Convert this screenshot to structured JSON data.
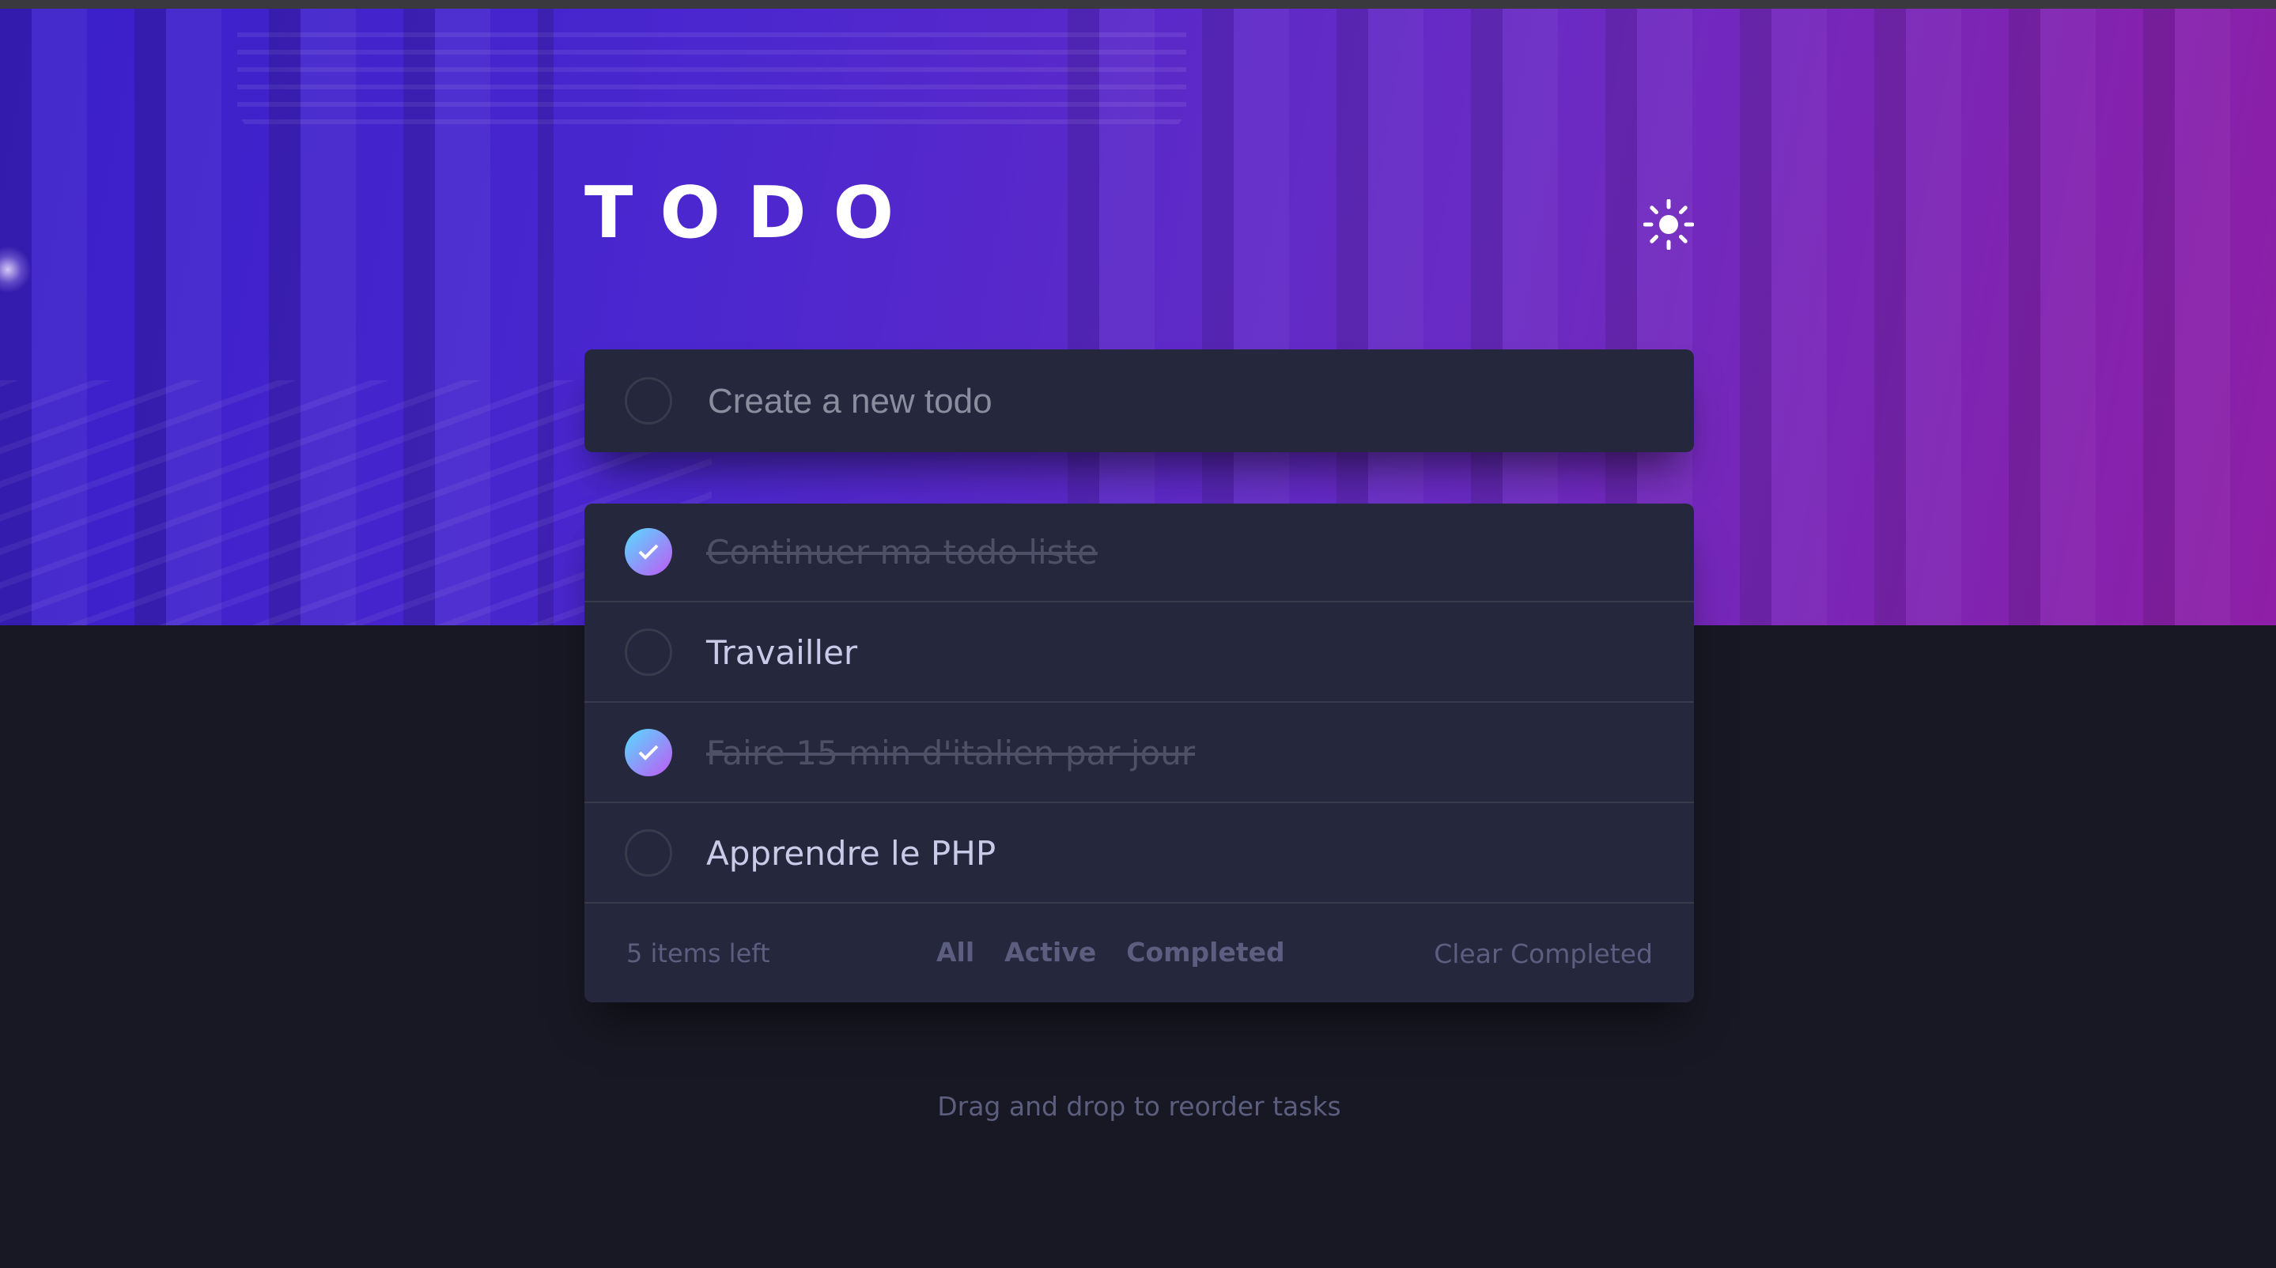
{
  "app": {
    "title": "TODO",
    "theme_icon": "sun-icon",
    "accent_gradient": [
      "#55ddff",
      "#c058f3"
    ]
  },
  "new_todo": {
    "placeholder": "Create a new todo",
    "value": ""
  },
  "todos": [
    {
      "text": "Continuer ma todo liste",
      "completed": true
    },
    {
      "text": "Travailler",
      "completed": false
    },
    {
      "text": "Faire 15 min d'italien par jour",
      "completed": true
    },
    {
      "text": "Apprendre le PHP",
      "completed": false
    }
  ],
  "footer": {
    "items_left": "5 items left",
    "filters": [
      "All",
      "Active",
      "Completed"
    ],
    "clear_label": "Clear Completed"
  },
  "hint": "Drag and drop to reorder tasks"
}
